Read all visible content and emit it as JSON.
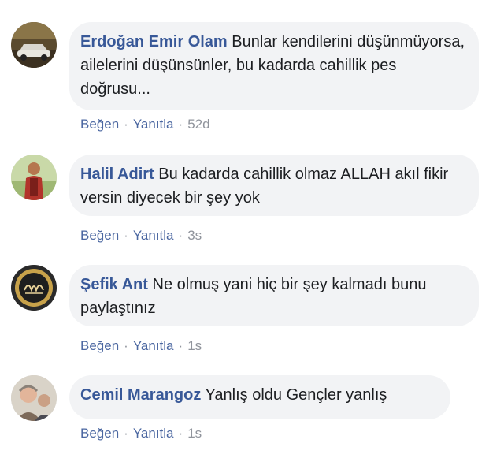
{
  "comments": [
    {
      "author": "Erdoğan Emir Olam",
      "text": "Bunlar kendilerini düşünmüyorsa, ailelerini düşünsünler, bu kadarda cahillik pes doğrusu...",
      "like_label": "Beğen",
      "reply_label": "Yanıtla",
      "time": "52d",
      "avatar_icon": "car-photo-avatar"
    },
    {
      "author": "Halil Adirt",
      "text": "Bu kadarda cahillik olmaz ALLAH akıl fikir versin diyecek bir şey yok",
      "like_label": "Beğen",
      "reply_label": "Yanıtla",
      "time": "3s",
      "avatar_icon": "person-photo-avatar"
    },
    {
      "author": "Şefik Ant",
      "text": "Ne olmuş yani hiç bir şey kalmadı bunu paylaştınız",
      "like_label": "Beğen",
      "reply_label": "Yanıtla",
      "time": "1s",
      "avatar_icon": "calligraphy-emblem-avatar"
    },
    {
      "author": "Cemil Marangoz",
      "text": "Yanlış oldu Gençler yanlış",
      "like_label": "Beğen",
      "reply_label": "Yanıtla",
      "time": "1s",
      "avatar_icon": "two-people-photo-avatar"
    }
  ],
  "separator": "·",
  "colors": {
    "author": "#385898",
    "bubble": "#f2f3f5",
    "action_link": "#4b67a1",
    "meta": "#90949c"
  }
}
